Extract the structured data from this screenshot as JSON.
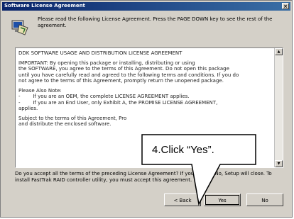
{
  "window": {
    "title": "Software License Agreement",
    "close_glyph": "×"
  },
  "instruction": "Please read the following License Agreement. Press the PAGE DOWN key to see the rest of the agreement.",
  "license": {
    "heading": "DDK SOFTWARE USAGE AND DISTRIBUTION LICENSE AGREEMENT",
    "important": [
      "IMPORTANT: By opening this package or installing, distributing or using",
      "the SOFTWARE, you agree to the terms of this Agreement. Do not open this package",
      "until you have carefully read and agreed to the following terms and conditions. If you do",
      "not agree to the terms of this Agreement, promptly return the unopened package."
    ],
    "note_title": "Please Also Note:",
    "note_lines": [
      "If you are an OEM, the complete LICENSE AGREEMENT applies.",
      "If you are an End User, only Exhibit A, the PROMISE LICENSE AGREEMENT,",
      "applies."
    ],
    "note_bullets": [
      "-",
      "-"
    ],
    "subject": [
      "Subject to the terms of this Agreement, Pro",
      "and distribute the enclosed software."
    ]
  },
  "question": "Do you accept all the terms of the preceding License Agreement? If you choose No, Setup will close. To install FastTrak RAID controller utility, you must accept this agreement.",
  "buttons": {
    "back": "< Back",
    "yes": "Yes",
    "no": "No"
  },
  "callout": {
    "text": "4.Click “Yes”."
  },
  "icons": {
    "setup": "setup-computer-icon",
    "scroll_up": "scroll-up-arrow-icon",
    "scroll_down": "scroll-down-arrow-icon"
  }
}
